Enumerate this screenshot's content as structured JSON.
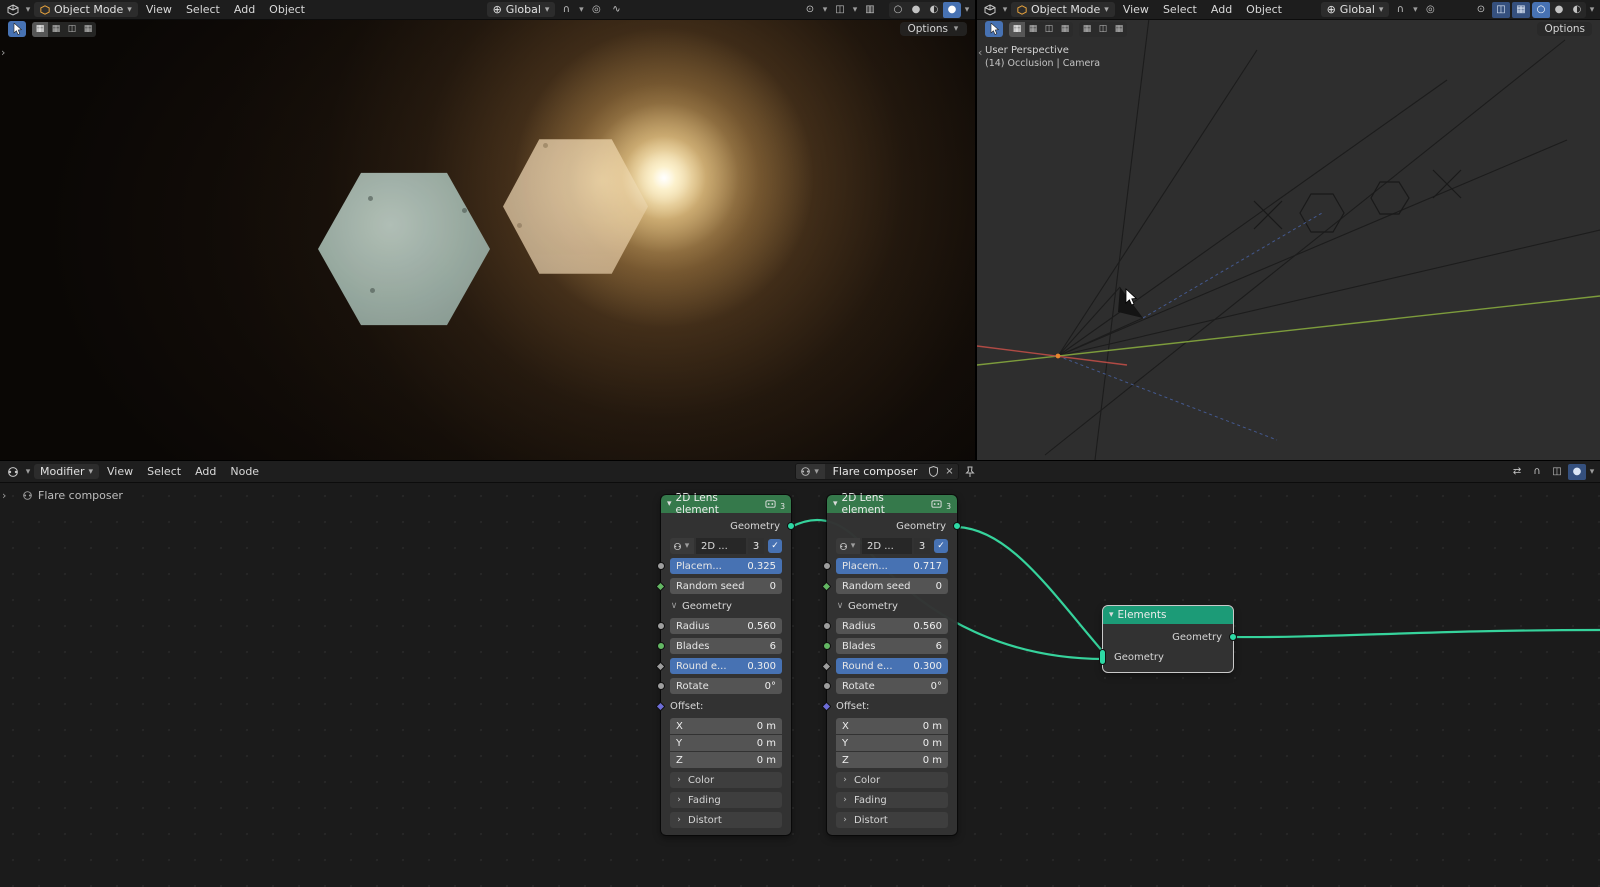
{
  "icons": {
    "chevron_down": "▾",
    "chevron_right": "›",
    "chevron_left": "‹",
    "section_open": "∨",
    "check": "✓",
    "close": "×",
    "globe": "⊕",
    "magnet": "∩",
    "proportional": "◎",
    "falloff": "∿",
    "gizmo": "⊙",
    "overlay": "◫",
    "xray": "▥",
    "grid": "▦",
    "arrows": "⇄",
    "sphere_wire": "○",
    "sphere_solid": "●",
    "sphere_material": "◐",
    "sphere_rendered": "●"
  },
  "viewport_left": {
    "header": {
      "mode_label": "Object Mode",
      "menu_view": "View",
      "menu_select": "Select",
      "menu_add": "Add",
      "menu_object": "Object",
      "orientation_label": "Global"
    },
    "tool_header": {
      "options_label": "Options"
    }
  },
  "viewport_right": {
    "header": {
      "mode_label": "Object Mode",
      "menu_view": "View",
      "menu_select": "Select",
      "menu_add": "Add",
      "menu_object": "Object",
      "orientation_label": "Global"
    },
    "tool_header": {
      "options_label": "Options"
    },
    "overlay": {
      "line1": "User Perspective",
      "line2": "(14) Occlusion | Camera"
    }
  },
  "node_editor": {
    "header": {
      "mode_label": "Modifier",
      "menu_view": "View",
      "menu_select": "Select",
      "menu_add": "Add",
      "menu_node": "Node",
      "tree_name": "Flare composer"
    },
    "breadcrumb": "Flare composer",
    "nodes": [
      {
        "title": "2D Lens element",
        "user_count": "3",
        "output_label": "Geometry",
        "datablock_name": "2D ...",
        "datablock_count": "3",
        "placement_label": "Placem...",
        "placement_value": "0.325",
        "seed_label": "Random seed",
        "seed_value": "0",
        "section_label": "Geometry",
        "radius_label": "Radius",
        "radius_value": "0.560",
        "blades_label": "Blades",
        "blades_value": "6",
        "round_label": "Round e...",
        "round_value": "0.300",
        "rotate_label": "Rotate",
        "rotate_value": "0°",
        "offset_label": "Offset:",
        "x_label": "X",
        "x_value": "0 m",
        "y_label": "Y",
        "y_value": "0 m",
        "z_label": "Z",
        "z_value": "0 m",
        "panel_color": "Color",
        "panel_fading": "Fading",
        "panel_distort": "Distort"
      },
      {
        "title": "2D Lens element",
        "user_count": "3",
        "output_label": "Geometry",
        "datablock_name": "2D ...",
        "datablock_count": "3",
        "placement_label": "Placem...",
        "placement_value": "0.717",
        "seed_label": "Random seed",
        "seed_value": "0",
        "section_label": "Geometry",
        "radius_label": "Radius",
        "radius_value": "0.560",
        "blades_label": "Blades",
        "blades_value": "6",
        "round_label": "Round e...",
        "round_value": "0.300",
        "rotate_label": "Rotate",
        "rotate_value": "0°",
        "offset_label": "Offset:",
        "x_label": "X",
        "x_value": "0 m",
        "y_label": "Y",
        "y_value": "0 m",
        "z_label": "Z",
        "z_value": "0 m",
        "panel_color": "Color",
        "panel_fading": "Fading",
        "panel_distort": "Distort"
      }
    ],
    "elements_node": {
      "title": "Elements",
      "output_label": "Geometry",
      "input_label": "Geometry"
    }
  },
  "colors": {
    "accent_blue": "#4772b3",
    "lens_header_green": "#35794b",
    "elements_header_teal": "#1c9b77",
    "wire_teal": "#36d39c",
    "geometry_socket": "#2ed9a5"
  }
}
